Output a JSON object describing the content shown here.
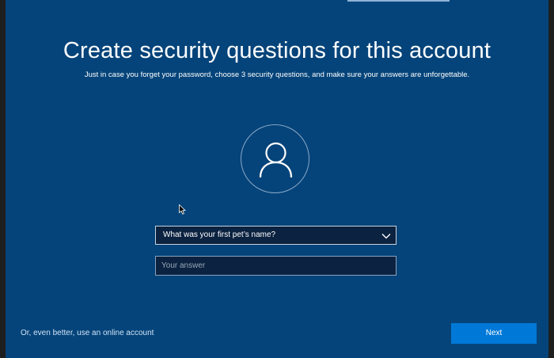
{
  "page": {
    "title": "Create security questions for this account",
    "subtitle": "Just in case you forget your password, choose 3 security questions, and make sure your answers are unforgettable."
  },
  "avatar": {
    "icon": "user-icon"
  },
  "question": {
    "selected": "What was your first pet’s name?",
    "icon": "chevron-down-icon"
  },
  "answer": {
    "placeholder": "Your answer",
    "value": ""
  },
  "footer": {
    "online_account_link": "Or, even better, use an online account",
    "next_label": "Next"
  },
  "colors": {
    "background": "#05447a",
    "accent": "#0078d7",
    "field_background": "#0b2240",
    "text": "#ffffff"
  }
}
